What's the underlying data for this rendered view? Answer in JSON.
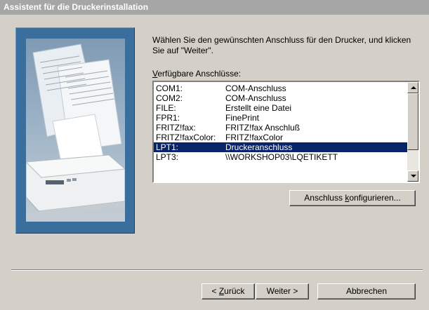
{
  "window": {
    "title": "Assistent für die Druckerinstallation"
  },
  "instruction": "Wählen Sie den gewünschten Anschluss für den Drucker, und klicken Sie auf \"Weiter\".",
  "list": {
    "label_mnemonic": "V",
    "label_rest": "erfügbare Anschlüsse:",
    "ports": [
      {
        "name": "COM1:",
        "description": "COM-Anschluss",
        "selected": false
      },
      {
        "name": "COM2:",
        "description": "COM-Anschluss",
        "selected": false
      },
      {
        "name": "FILE:",
        "description": "Erstellt eine Datei",
        "selected": false
      },
      {
        "name": "FPR1:",
        "description": "FinePrint",
        "selected": false
      },
      {
        "name": "FRITZ!fax:",
        "description": "FRITZ!fax Anschluß",
        "selected": false
      },
      {
        "name": "FRITZ!faxColor:",
        "description": "FRITZ!faxColor",
        "selected": false
      },
      {
        "name": "LPT1:",
        "description": "Druckeranschluss",
        "selected": true
      },
      {
        "name": "LPT3:",
        "description": "\\\\WORKSHOP03\\LQETIKETT",
        "selected": false
      }
    ]
  },
  "buttons": {
    "configure_pre": "Anschluss ",
    "configure_mnemonic": "k",
    "configure_post": "onfigurieren...",
    "back_pre": "< ",
    "back_mnemonic": "Z",
    "back_post": "urück",
    "next": "Weiter >",
    "cancel": "Abbrechen"
  },
  "colors": {
    "selection": "#0a246a",
    "dialog_face": "#d4d0c8",
    "illustration_frame": "#3a6e9d"
  }
}
